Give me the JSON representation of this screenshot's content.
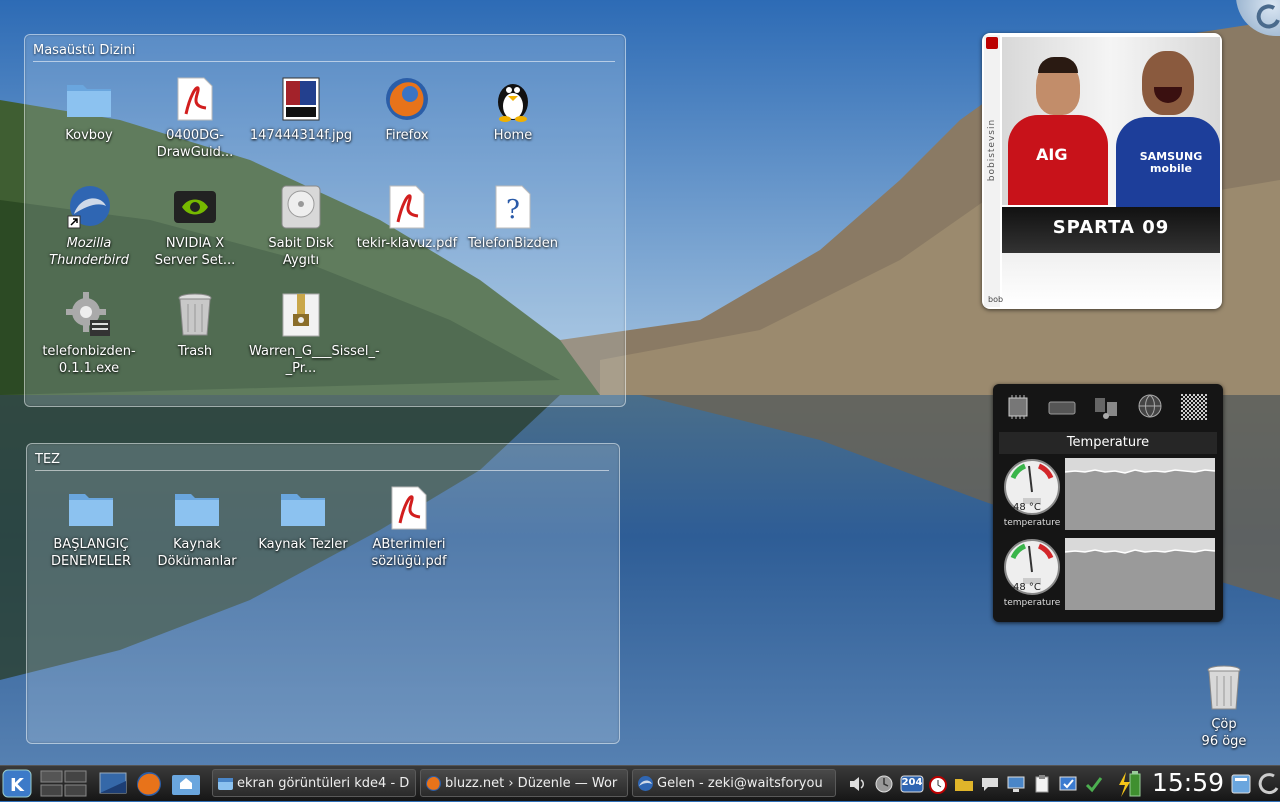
{
  "desktop_folder_1": {
    "title": "Masaüstü Dizini",
    "items": [
      {
        "label": "Kovboy",
        "icon": "folder-icon"
      },
      {
        "label": "0400DG-DrawGuid...",
        "icon": "pdf-icon"
      },
      {
        "label": "147444314f.jpg",
        "icon": "image-thumbnail-icon"
      },
      {
        "label": "Firefox",
        "icon": "firefox-icon"
      },
      {
        "label": "Home",
        "icon": "penguin-home-icon"
      },
      {
        "label": "Mozilla Thunderbird",
        "icon": "thunderbird-icon"
      },
      {
        "label": "NVIDIA X Server Set...",
        "icon": "nvidia-icon"
      },
      {
        "label": "Sabit Disk Aygıtı",
        "icon": "hard-disk-icon"
      },
      {
        "label": "tekir-klavuz.pdf",
        "icon": "pdf-icon"
      },
      {
        "label": "TelefonBizden",
        "icon": "unknown-file-icon"
      },
      {
        "label": "telefonbizden-0.1.1.exe",
        "icon": "exe-gear-icon"
      },
      {
        "label": "Trash",
        "icon": "trash-icon"
      },
      {
        "label": "Warren_G___Sissel_-_Pr...",
        "icon": "archive-icon"
      }
    ]
  },
  "desktop_folder_2": {
    "title": "TEZ",
    "items": [
      {
        "label": "BAŞLANGIÇ DENEMELER",
        "icon": "folder-icon"
      },
      {
        "label": "Kaynak Dökümanlar",
        "icon": "folder-icon"
      },
      {
        "label": "Kaynak Tezler",
        "icon": "folder-icon"
      },
      {
        "label": "ABterimlerisözlüğü.pdf",
        "icon": "pdf-icon"
      }
    ]
  },
  "picture_frame": {
    "caption_side": "bobistevsin",
    "game_title": "SPARTA 09",
    "jersey_text": "SAMSUNG mobile",
    "jersey_left": "AIG",
    "bottom_text": "bob"
  },
  "system_monitor": {
    "title": "Temperature",
    "buttons": [
      "cpu-icon",
      "hard-disk-icon",
      "network-icon",
      "globe-icon",
      "pattern-icon"
    ],
    "sensors": [
      {
        "value": "48 °C",
        "label": "temperature"
      },
      {
        "value": "48 °C",
        "label": "temperature"
      }
    ]
  },
  "desktop_trash": {
    "label": "Çöp",
    "count": "96 öge"
  },
  "taskbar": {
    "tasks": [
      {
        "label": "ekran görüntüleri kde4 - D",
        "icon": "dolphin-icon"
      },
      {
        "label": "bluzz.net › Düzenle — Wor",
        "icon": "firefox-icon"
      },
      {
        "label": "Gelen - zeki@waitsforyou",
        "icon": "thunderbird-icon"
      }
    ],
    "tray_badge": "204",
    "clock": "15:59"
  },
  "colors": {
    "taskbar_bg": "#1e1e1e",
    "folder_blue": "#7fb4e8",
    "pdf_red": "#d21e1e"
  }
}
